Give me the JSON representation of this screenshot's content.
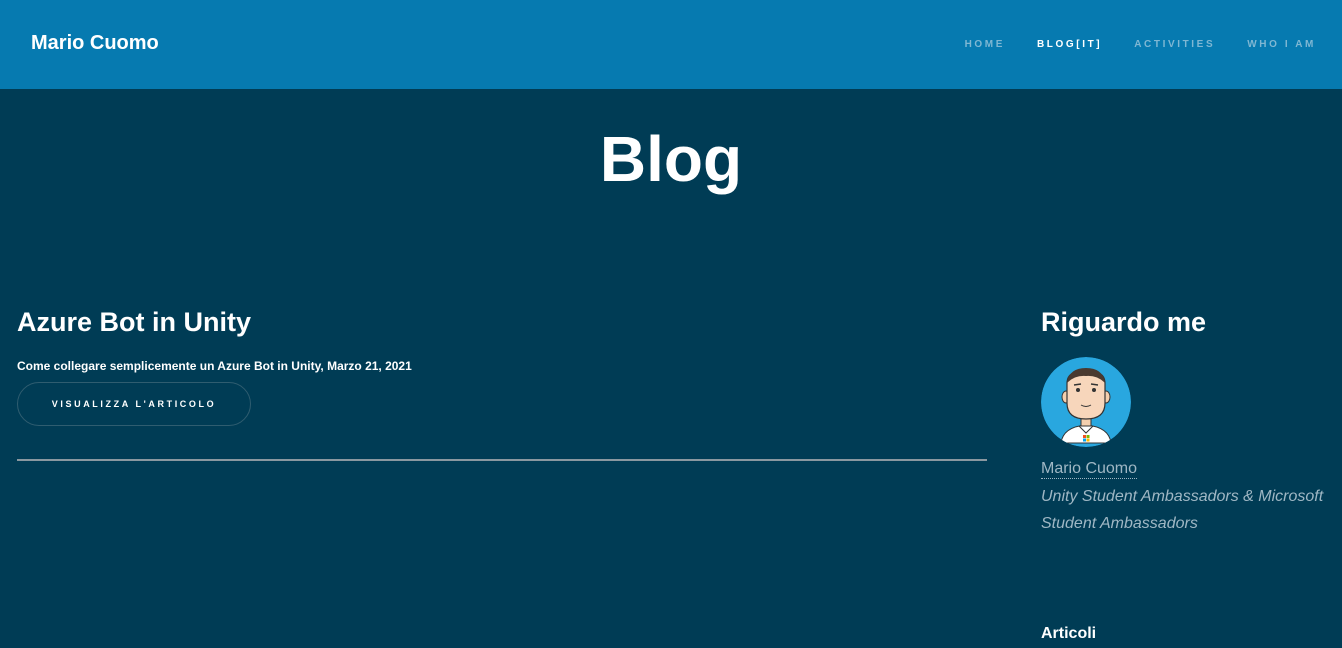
{
  "header": {
    "brand": "Mario Cuomo",
    "nav": [
      {
        "label": "HOME"
      },
      {
        "label": "BLOG[IT]"
      },
      {
        "label": "ACTIVITIES"
      },
      {
        "label": "WHO I AM"
      }
    ],
    "active_nav": "BLOG[IT]"
  },
  "page": {
    "title": "Blog"
  },
  "posts": [
    {
      "title": "Azure Bot in Unity",
      "meta": "Come collegare semplicemente un Azure Bot in Unity, Marzo 21, 2021",
      "button": "VISUALIZZA L'ARTICOLO"
    }
  ],
  "sidebar": {
    "title": "Riguardo me",
    "avatar_icon": "avatar-illustration",
    "name": "Mario Cuomo",
    "bio": "Unity Student Ambassadors & Microsoft Student Ambassadors",
    "section_title": "Articoli"
  },
  "colors": {
    "header_bg": "#067ab0",
    "page_bg": "#003c55",
    "nav_inactive": "#7fb7d3",
    "muted_text": "#9fb7c4"
  }
}
